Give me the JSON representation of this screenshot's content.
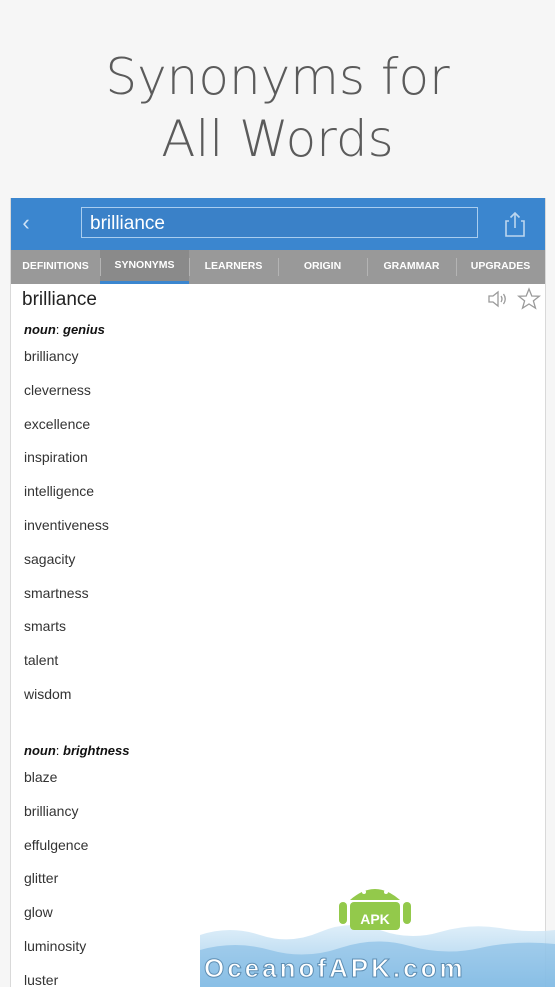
{
  "promo": {
    "line1": "Synonyms for",
    "line2": "All Words"
  },
  "topbar": {
    "back_glyph": "‹",
    "search_value": "brilliance"
  },
  "tabs": [
    {
      "label": "DEFINITIONS"
    },
    {
      "label": "SYNONYMS"
    },
    {
      "label": "LEARNERS"
    },
    {
      "label": "ORIGIN"
    },
    {
      "label": "GRAMMAR"
    },
    {
      "label": "UPGRADES"
    }
  ],
  "entry": {
    "word": "brilliance",
    "senses": [
      {
        "pos": "noun",
        "sep": ": ",
        "meaning": "genius",
        "synonyms": [
          "brilliancy",
          "cleverness",
          "excellence",
          "inspiration",
          "intelligence",
          "inventiveness",
          "sagacity",
          "smartness",
          "smarts",
          "talent",
          "wisdom"
        ]
      },
      {
        "pos": "noun",
        "sep": ": ",
        "meaning": "brightness",
        "synonyms": [
          "blaze",
          "brilliancy",
          "effulgence",
          "glitter",
          "glow",
          "luminosity",
          "luster"
        ]
      }
    ]
  },
  "watermark": {
    "text": "OceanofAPK.com",
    "badge": "APK"
  },
  "colors": {
    "accent": "#3b86cf",
    "tab_bg": "#999999"
  }
}
